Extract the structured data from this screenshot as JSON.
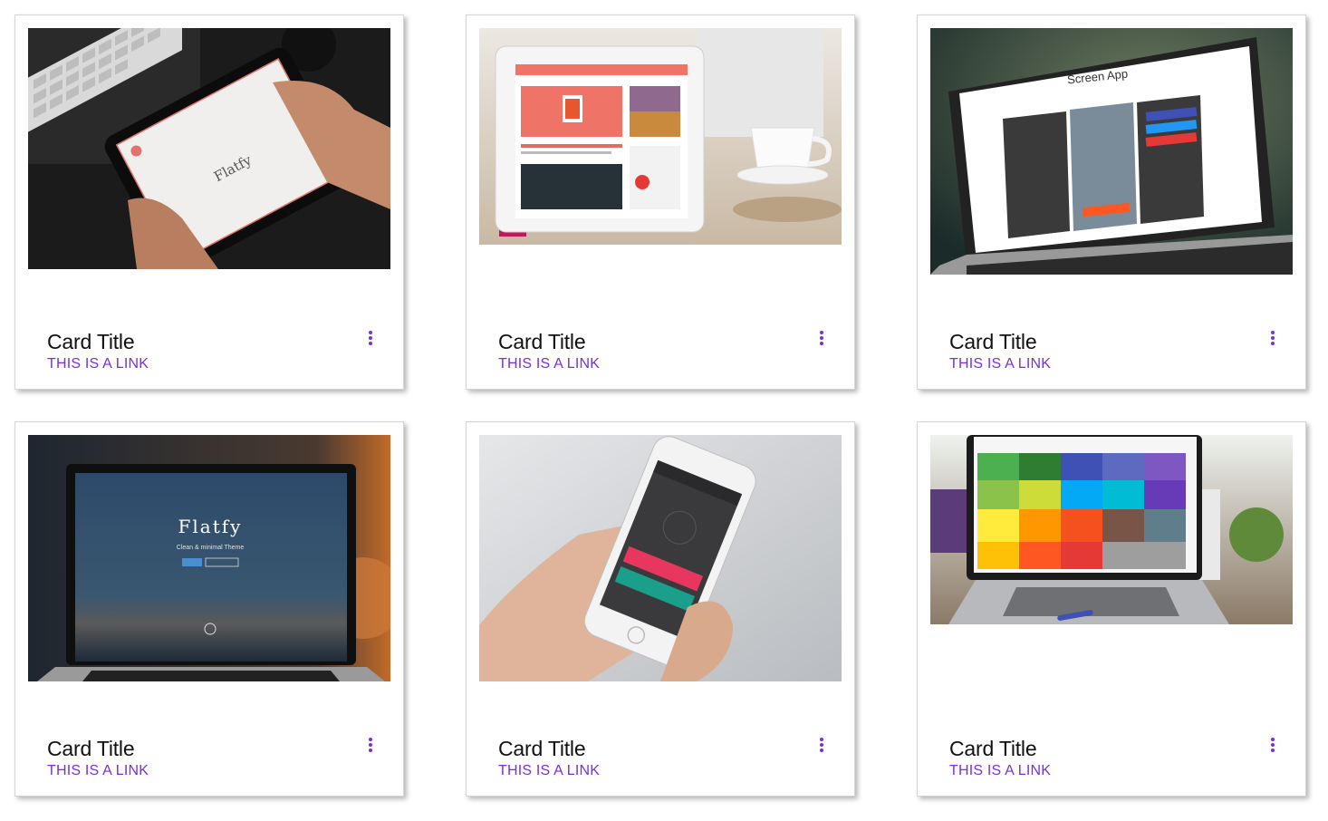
{
  "accent_color": "#7b2fd6",
  "cards": [
    {
      "title": "Card Title",
      "link": "THIS IS A LINK",
      "image_text": "Flatfy",
      "menu_icon": "more-vert-icon"
    },
    {
      "title": "Card Title",
      "link": "THIS IS A LINK",
      "image_text": "",
      "menu_icon": "more-vert-icon"
    },
    {
      "title": "Card Title",
      "link": "THIS IS A LINK",
      "image_text": "Screen App",
      "menu_icon": "more-vert-icon"
    },
    {
      "title": "Card Title",
      "link": "THIS IS A LINK",
      "image_text": "Flatfy",
      "image_subtext": "Clean & minimal Theme",
      "menu_icon": "more-vert-icon"
    },
    {
      "title": "Card Title",
      "link": "THIS IS A LINK",
      "image_text": "",
      "menu_icon": "more-vert-icon"
    },
    {
      "title": "Card Title",
      "link": "THIS IS A LINK",
      "image_text": "",
      "menu_icon": "more-vert-icon"
    }
  ]
}
